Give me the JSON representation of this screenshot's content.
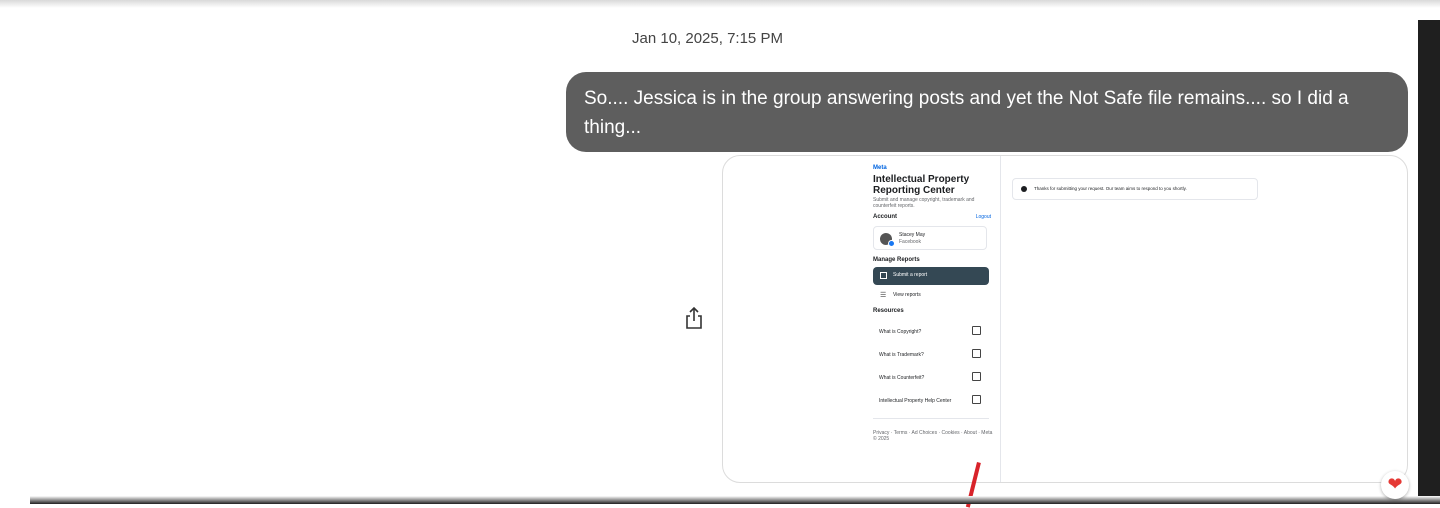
{
  "conversation": {
    "timestamp": "Jan 10, 2025, 7:15 PM",
    "message": "So.... Jessica is in the group answering posts and yet the Not Safe file remains.... so I did a thing..."
  },
  "attachment": {
    "meta_logo": "Meta",
    "title": "Intellectual Property Reporting Center",
    "subtitle": "Submit and manage copyright, trademark and counterfeit reports.",
    "account_label": "Account",
    "logout": "Logout",
    "account_name": "Stacey May",
    "account_network": "Facebook",
    "manage_label": "Manage Reports",
    "submit_report": "Submit a report",
    "view_reports": "View reports",
    "resources_label": "Resources",
    "resources": [
      "What is Copyright?",
      "What is Trademark?",
      "What is Counterfeit?",
      "Intellectual Property Help Center"
    ],
    "footer": "Privacy · Terms · Ad Choices · Cookies · About · Meta © 2025",
    "notice": "Thanks for submitting your request. Our team aims to respond to you shortly."
  },
  "reaction": {
    "icon": "heart-icon",
    "glyph": "❤",
    "color": "#e53935"
  },
  "colors": {
    "bubble": "#5e5e5e",
    "submit_button": "#344854"
  }
}
